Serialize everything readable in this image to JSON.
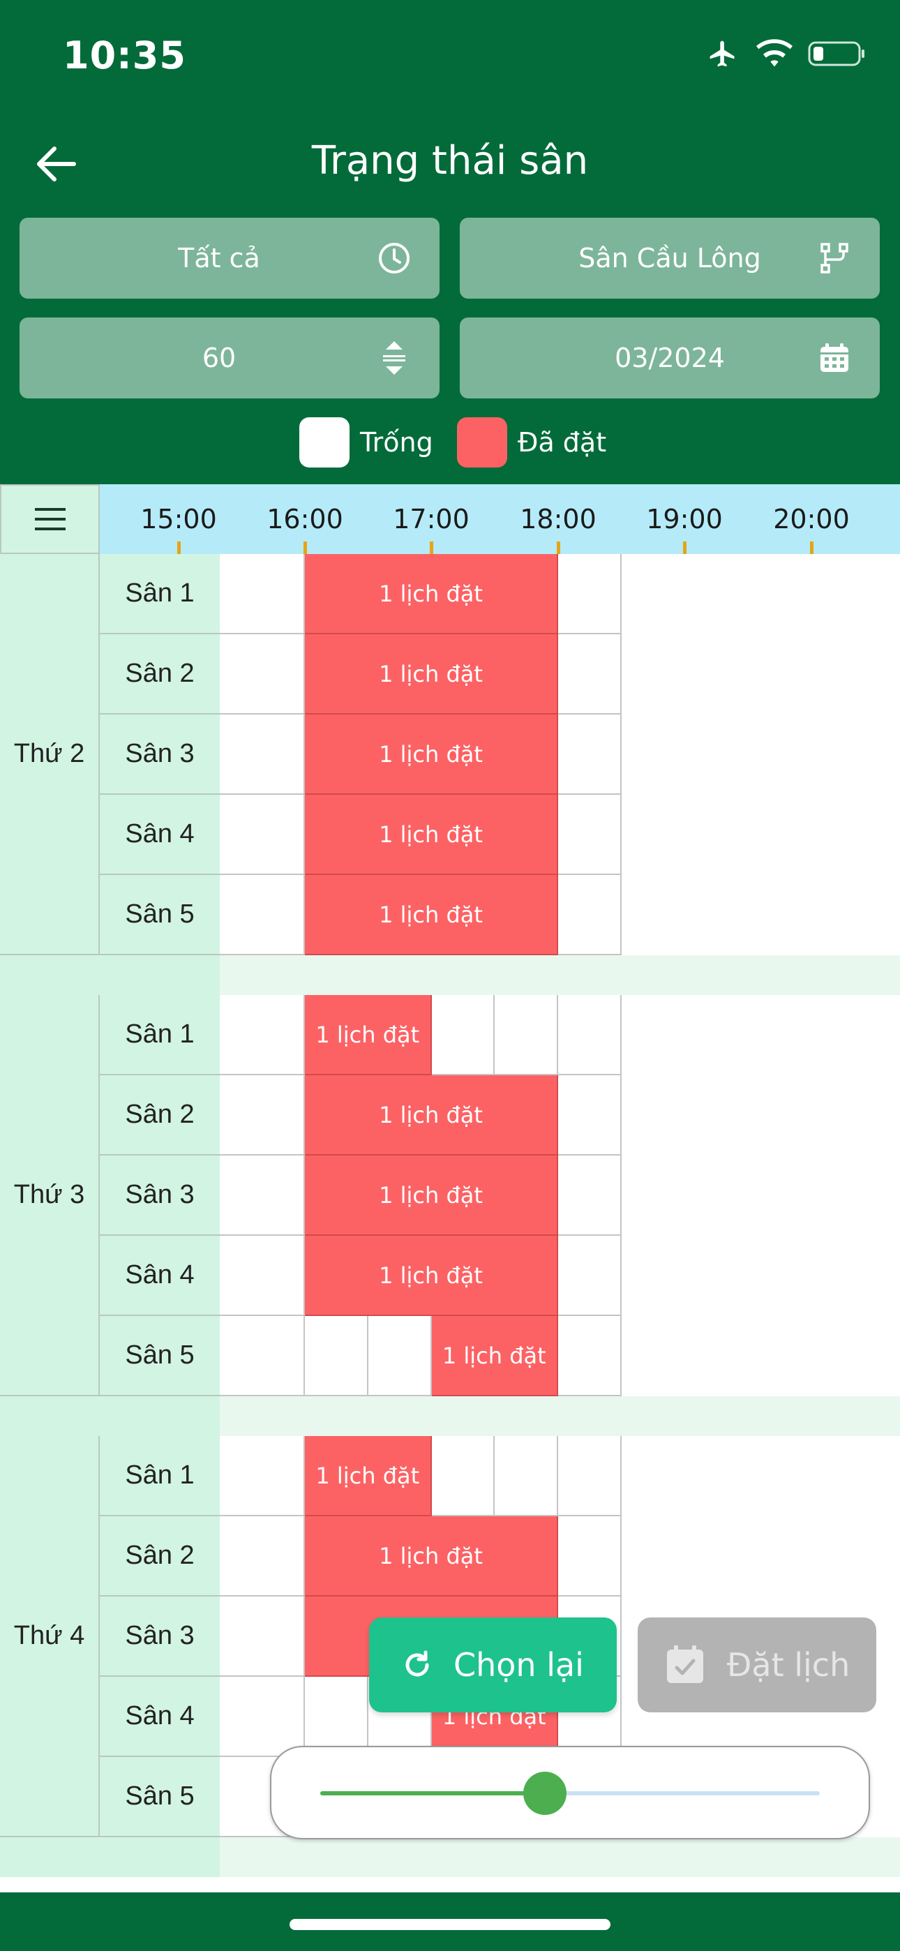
{
  "status_bar": {
    "time": "10:35"
  },
  "header": {
    "title": "Trạng thái sân"
  },
  "filters": {
    "time_filter": "Tất cả",
    "sport_filter": "Sân Cầu Lông",
    "duration": "60",
    "month": "03/2024"
  },
  "legend": {
    "empty_label": "Trống",
    "booked_label": "Đã đặt",
    "empty_color": "#ffffff",
    "booked_color": "#fc6264"
  },
  "time_slots": [
    "15:00",
    "16:00",
    "17:00",
    "18:00",
    "19:00",
    "20:00"
  ],
  "booking_text": "1 lịch đặt",
  "days": [
    {
      "label": "Thứ 2",
      "courts": [
        {
          "label": "Sân 1",
          "blocks": [
            [
              "e",
              1
            ],
            [
              "b",
              4
            ],
            [
              "e",
              1
            ]
          ]
        },
        {
          "label": "Sân 2",
          "blocks": [
            [
              "e",
              1
            ],
            [
              "b",
              4
            ],
            [
              "e",
              1
            ]
          ]
        },
        {
          "label": "Sân 3",
          "blocks": [
            [
              "e",
              1
            ],
            [
              "b",
              4
            ],
            [
              "e",
              1
            ]
          ]
        },
        {
          "label": "Sân 4",
          "blocks": [
            [
              "e",
              1
            ],
            [
              "b",
              4
            ],
            [
              "e",
              1
            ]
          ]
        },
        {
          "label": "Sân 5",
          "blocks": [
            [
              "e",
              1
            ],
            [
              "b",
              4
            ],
            [
              "e",
              1
            ]
          ]
        }
      ]
    },
    {
      "label": "Thứ 3",
      "courts": [
        {
          "label": "Sân 1",
          "blocks": [
            [
              "e",
              1
            ],
            [
              "b",
              2
            ],
            [
              "e",
              1
            ],
            [
              "e",
              1
            ],
            [
              "e",
              1
            ]
          ]
        },
        {
          "label": "Sân 2",
          "blocks": [
            [
              "e",
              1
            ],
            [
              "b",
              4
            ],
            [
              "e",
              1
            ]
          ]
        },
        {
          "label": "Sân 3",
          "blocks": [
            [
              "e",
              1
            ],
            [
              "b",
              4
            ],
            [
              "e",
              1
            ]
          ]
        },
        {
          "label": "Sân 4",
          "blocks": [
            [
              "e",
              1
            ],
            [
              "b",
              4
            ],
            [
              "e",
              1
            ]
          ]
        },
        {
          "label": "Sân 5",
          "blocks": [
            [
              "e",
              1
            ],
            [
              "e",
              1
            ],
            [
              "e",
              1
            ],
            [
              "b",
              2
            ],
            [
              "e",
              1
            ]
          ]
        }
      ]
    },
    {
      "label": "Thứ 4",
      "courts": [
        {
          "label": "Sân 1",
          "blocks": [
            [
              "e",
              1
            ],
            [
              "b",
              2
            ],
            [
              "e",
              1
            ],
            [
              "e",
              1
            ],
            [
              "e",
              1
            ]
          ]
        },
        {
          "label": "Sân 2",
          "blocks": [
            [
              "e",
              1
            ],
            [
              "b",
              4
            ],
            [
              "e",
              1
            ]
          ]
        },
        {
          "label": "Sân 3",
          "blocks": [
            [
              "e",
              1
            ],
            [
              "b",
              4
            ],
            [
              "e",
              1
            ]
          ]
        },
        {
          "label": "Sân 4",
          "blocks": [
            [
              "e",
              1
            ],
            [
              "e",
              1
            ],
            [
              "e",
              1
            ],
            [
              "b",
              2
            ],
            [
              "e",
              1
            ]
          ]
        },
        {
          "label": "Sân 5",
          "blocks": [
            [
              "e",
              1
            ],
            [
              "e",
              6
            ]
          ]
        }
      ]
    }
  ],
  "actions": {
    "reset_label": "Chọn lại",
    "book_label": "Đặt lịch"
  },
  "zoom_slider": {
    "value": 0.45
  }
}
